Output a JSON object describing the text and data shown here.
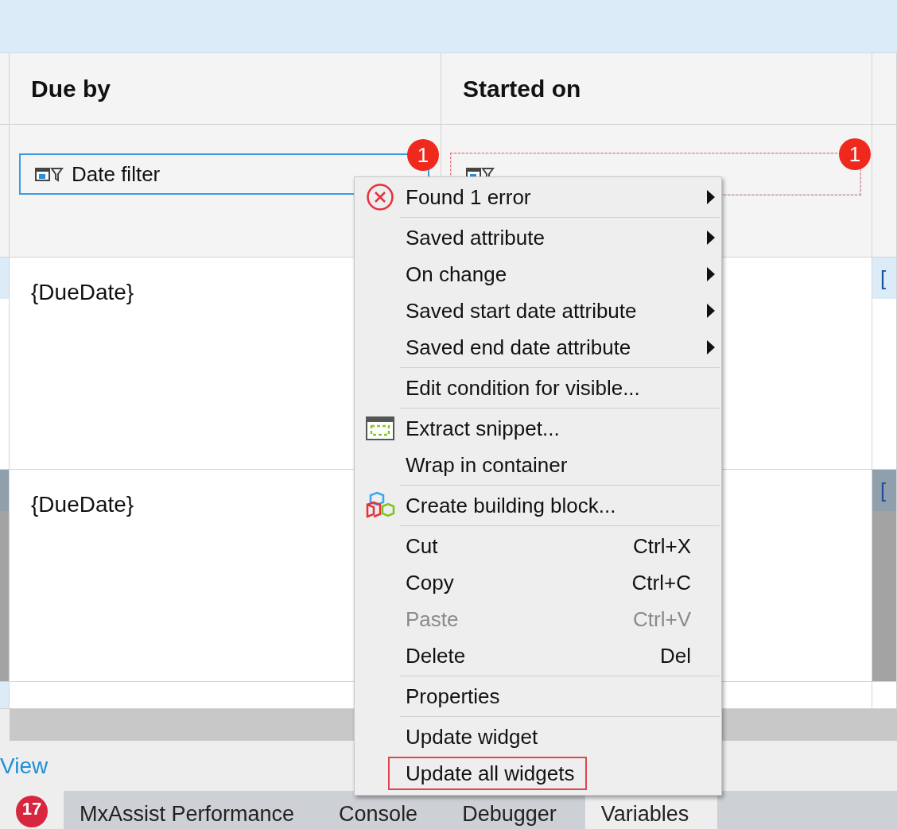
{
  "table": {
    "columns": [
      {
        "header": "Due by"
      },
      {
        "header": "Started on"
      }
    ],
    "filters": [
      {
        "label": "Date filter",
        "error_count": "1",
        "selected": true,
        "has_error": false
      },
      {
        "error_count": "1",
        "selected": false,
        "has_error": true
      }
    ],
    "rows": [
      {
        "cells": [
          "{DueDate}"
        ],
        "column_3": "[",
        "selected": false
      },
      {
        "cells": [
          "{DueDate}"
        ],
        "column_3": "[",
        "selected": true
      },
      {
        "selected": false
      }
    ]
  },
  "view_link": "View",
  "bottom_tabs": [
    {
      "label": "17",
      "kind": "badge",
      "selected": true
    },
    {
      "label": "MxAssist Performance",
      "kind": "tab",
      "selected": false
    },
    {
      "label": "Console",
      "kind": "tab",
      "selected": false
    },
    {
      "label": "Debugger",
      "kind": "tab",
      "selected": false
    },
    {
      "label": "Variables",
      "kind": "tab",
      "selected": true
    }
  ],
  "context_menu": {
    "groups": [
      [
        {
          "label": "Found 1 error",
          "kind": "error",
          "submenu": true,
          "disabled": false
        }
      ],
      [
        {
          "label": "Saved attribute",
          "kind": "plain",
          "submenu": true,
          "disabled": false
        },
        {
          "label": "On change",
          "kind": "plain",
          "submenu": true,
          "disabled": false
        },
        {
          "label": "Saved start date attribute",
          "kind": "plain",
          "submenu": true,
          "disabled": false
        },
        {
          "label": "Saved end date attribute",
          "kind": "plain",
          "submenu": true,
          "disabled": false
        }
      ],
      [
        {
          "label": "Edit condition for visible...",
          "kind": "plain",
          "submenu": false,
          "disabled": false
        }
      ],
      [
        {
          "label": "Extract snippet...",
          "kind": "snippet",
          "submenu": false,
          "disabled": false
        },
        {
          "label": "Wrap in container",
          "kind": "plain",
          "submenu": false,
          "disabled": false
        }
      ],
      [
        {
          "label": "Create building block...",
          "kind": "blocks",
          "submenu": false,
          "disabled": false
        }
      ],
      [
        {
          "label": "Cut",
          "kind": "plain",
          "shortcut": "Ctrl+X",
          "submenu": false,
          "disabled": false
        },
        {
          "label": "Copy",
          "kind": "plain",
          "shortcut": "Ctrl+C",
          "submenu": false,
          "disabled": false
        },
        {
          "label": "Paste",
          "kind": "plain",
          "shortcut": "Ctrl+V",
          "submenu": false,
          "disabled": true
        },
        {
          "label": "Delete",
          "kind": "plain",
          "shortcut": "Del",
          "submenu": false,
          "disabled": false
        }
      ],
      [
        {
          "label": "Properties",
          "kind": "plain",
          "submenu": false,
          "disabled": false
        }
      ],
      [
        {
          "label": "Update widget",
          "kind": "plain",
          "submenu": false,
          "disabled": false
        },
        {
          "label": "Update all widgets",
          "kind": "plain",
          "submenu": false,
          "disabled": false,
          "outlined": true
        }
      ]
    ]
  }
}
